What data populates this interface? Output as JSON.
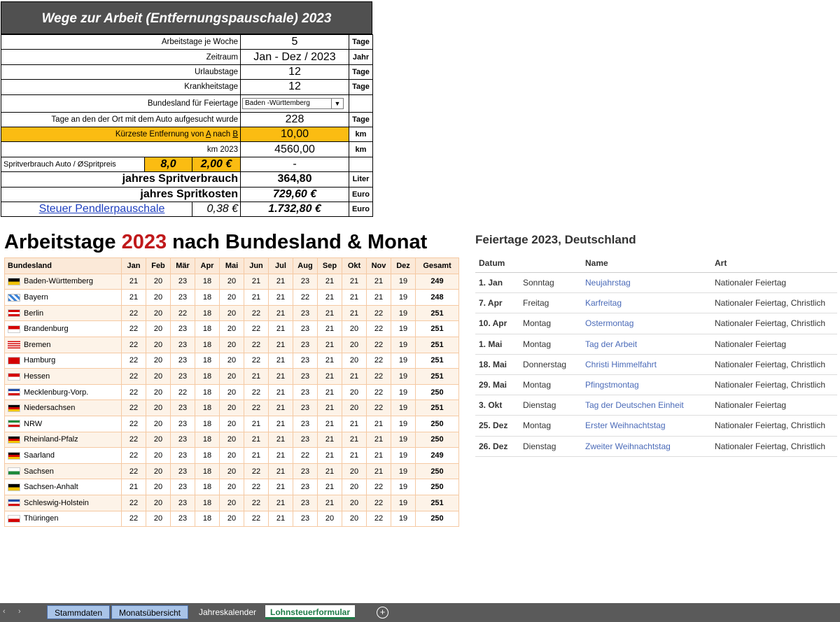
{
  "calc": {
    "title": "Wege zur Arbeit  (Entfernungspauschale)  2023",
    "rows": {
      "arbeitstage": {
        "label": "Arbeitstage je Woche",
        "value": "5",
        "unit": "Tage"
      },
      "zeitraum": {
        "label": "Zeitraum",
        "value": "Jan - Dez / 2023",
        "unit": "Jahr"
      },
      "urlaub": {
        "label": "Urlaubstage",
        "value": "12",
        "unit": "Tage"
      },
      "krank": {
        "label": "Krankheitstage",
        "value": "12",
        "unit": "Tage"
      },
      "bundesland": {
        "label": "Bundesland für Feiertage",
        "value": "Baden -Württemberg"
      },
      "tage_ort": {
        "label": "Tage an den der Ort mit dem Auto aufgesucht wurde",
        "value": "228",
        "unit": "Tage"
      },
      "entfernung": {
        "label_pre": "Kürzeste Entfernung von ",
        "label_a": "A",
        "label_mid": " nach ",
        "label_b": "B",
        "value": "10,00",
        "unit": "km"
      },
      "km": {
        "label": "km 2023",
        "value": "4560,00",
        "unit": "km"
      },
      "sprit": {
        "label": "Spritverbrauch Auto / ØSpritpreis",
        "verbrauch": "8,0",
        "preis": "2,00 €",
        "value": "-"
      },
      "jahresverbrauch": {
        "label": "jahres Spritverbrauch",
        "value": "364,80",
        "unit": "Liter"
      },
      "jahreskosten": {
        "label": "jahres Spritkosten",
        "value": "729,60 €",
        "unit": "Euro"
      },
      "pendler": {
        "label": "Steuer Pendlerpauschale",
        "rate": "0,38 €",
        "value": "1.732,80 €",
        "unit": "Euro"
      }
    }
  },
  "workdays": {
    "title_pre": "Arbeitstage ",
    "title_year": "2023",
    "title_post": " nach Bundesland & Monat",
    "headers": [
      "Bundesland",
      "Jan",
      "Feb",
      "Mär",
      "Apr",
      "Mai",
      "Jun",
      "Jul",
      "Aug",
      "Sep",
      "Okt",
      "Nov",
      "Dez",
      "Gesamt"
    ],
    "rows": [
      {
        "land": "Baden-Württemberg",
        "flag": [
          "#000000",
          "#f2c300"
        ],
        "m": [
          "21",
          "20",
          "23",
          "18",
          "20",
          "21",
          "21",
          "23",
          "21",
          "21",
          "21",
          "19"
        ],
        "sum": "249"
      },
      {
        "land": "Bayern",
        "flag": [
          "bayern"
        ],
        "m": [
          "21",
          "20",
          "23",
          "18",
          "20",
          "21",
          "21",
          "22",
          "21",
          "21",
          "21",
          "19"
        ],
        "sum": "248"
      },
      {
        "land": "Berlin",
        "flag": [
          "#d40000",
          "#ffffff",
          "#d40000"
        ],
        "m": [
          "22",
          "20",
          "22",
          "18",
          "20",
          "22",
          "21",
          "23",
          "21",
          "21",
          "22",
          "19"
        ],
        "sum": "251"
      },
      {
        "land": "Brandenburg",
        "flag": [
          "#d40000",
          "#ffffff"
        ],
        "m": [
          "22",
          "20",
          "23",
          "18",
          "20",
          "22",
          "21",
          "23",
          "21",
          "20",
          "22",
          "19"
        ],
        "sum": "251"
      },
      {
        "land": "Bremen",
        "flag": [
          "stripes-red"
        ],
        "m": [
          "22",
          "20",
          "23",
          "18",
          "20",
          "22",
          "21",
          "23",
          "21",
          "20",
          "22",
          "19"
        ],
        "sum": "251"
      },
      {
        "land": "Hamburg",
        "flag": [
          "#d40000"
        ],
        "m": [
          "22",
          "20",
          "23",
          "18",
          "20",
          "22",
          "21",
          "23",
          "21",
          "20",
          "22",
          "19"
        ],
        "sum": "251"
      },
      {
        "land": "Hessen",
        "flag": [
          "#d40000",
          "#ffffff"
        ],
        "m": [
          "22",
          "20",
          "23",
          "18",
          "20",
          "21",
          "21",
          "23",
          "21",
          "21",
          "22",
          "19"
        ],
        "sum": "251"
      },
      {
        "land": "Mecklenburg-Vorp.",
        "flag": [
          "#1f4ca8",
          "#ffffff",
          "#d40000"
        ],
        "m": [
          "22",
          "20",
          "22",
          "18",
          "20",
          "22",
          "21",
          "23",
          "21",
          "20",
          "22",
          "19"
        ],
        "sum": "250"
      },
      {
        "land": "Niedersachsen",
        "flag": [
          "#000000",
          "#d40000",
          "#f2c300"
        ],
        "m": [
          "22",
          "20",
          "23",
          "18",
          "20",
          "22",
          "21",
          "23",
          "21",
          "20",
          "22",
          "19"
        ],
        "sum": "251"
      },
      {
        "land": "NRW",
        "flag": [
          "#1e8a3b",
          "#ffffff",
          "#d40000"
        ],
        "m": [
          "22",
          "20",
          "23",
          "18",
          "20",
          "21",
          "21",
          "23",
          "21",
          "21",
          "21",
          "19"
        ],
        "sum": "250"
      },
      {
        "land": "Rheinland-Pfalz",
        "flag": [
          "#000000",
          "#d40000",
          "#f2c300"
        ],
        "m": [
          "22",
          "20",
          "23",
          "18",
          "20",
          "21",
          "21",
          "23",
          "21",
          "21",
          "21",
          "19"
        ],
        "sum": "250"
      },
      {
        "land": "Saarland",
        "flag": [
          "#000000",
          "#d40000",
          "#f2c300"
        ],
        "m": [
          "22",
          "20",
          "23",
          "18",
          "20",
          "21",
          "21",
          "22",
          "21",
          "21",
          "21",
          "19"
        ],
        "sum": "249"
      },
      {
        "land": "Sachsen",
        "flag": [
          "#ffffff",
          "#1e8a3b"
        ],
        "m": [
          "22",
          "20",
          "23",
          "18",
          "20",
          "22",
          "21",
          "23",
          "21",
          "20",
          "21",
          "19"
        ],
        "sum": "250"
      },
      {
        "land": "Sachsen-Anhalt",
        "flag": [
          "#000000",
          "#f2c300"
        ],
        "m": [
          "21",
          "20",
          "23",
          "18",
          "20",
          "22",
          "21",
          "23",
          "21",
          "20",
          "22",
          "19"
        ],
        "sum": "250"
      },
      {
        "land": "Schleswig-Holstein",
        "flag": [
          "#1f4ca8",
          "#ffffff",
          "#d40000"
        ],
        "m": [
          "22",
          "20",
          "23",
          "18",
          "20",
          "22",
          "21",
          "23",
          "21",
          "20",
          "22",
          "19"
        ],
        "sum": "251"
      },
      {
        "land": "Thüringen",
        "flag": [
          "#ffffff",
          "#d40000"
        ],
        "m": [
          "22",
          "20",
          "23",
          "18",
          "20",
          "22",
          "21",
          "23",
          "20",
          "20",
          "22",
          "19"
        ],
        "sum": "250"
      }
    ]
  },
  "holidays": {
    "title": "Feiertage 2023, Deutschland",
    "headers": {
      "datum": "Datum",
      "name": "Name",
      "art": "Art"
    },
    "rows": [
      {
        "datum": "1. Jan",
        "tag": "Sonntag",
        "name": "Neujahrstag",
        "art": "Nationaler Feiertag"
      },
      {
        "datum": "7. Apr",
        "tag": "Freitag",
        "name": "Karfreitag",
        "art": "Nationaler Feiertag, Christlich"
      },
      {
        "datum": "10. Apr",
        "tag": "Montag",
        "name": "Ostermontag",
        "art": "Nationaler Feiertag, Christlich"
      },
      {
        "datum": "1. Mai",
        "tag": "Montag",
        "name": "Tag der Arbeit",
        "art": "Nationaler Feiertag"
      },
      {
        "datum": "18. Mai",
        "tag": "Donnerstag",
        "name": "Christi Himmelfahrt",
        "art": "Nationaler Feiertag, Christlich"
      },
      {
        "datum": "29. Mai",
        "tag": "Montag",
        "name": "Pfingstmontag",
        "art": "Nationaler Feiertag, Christlich"
      },
      {
        "datum": "3. Okt",
        "tag": "Dienstag",
        "name": "Tag der Deutschen Einheit",
        "art": "Nationaler Feiertag"
      },
      {
        "datum": "25. Dez",
        "tag": "Montag",
        "name": "Erster Weihnachtstag",
        "art": "Nationaler Feiertag, Christlich"
      },
      {
        "datum": "26. Dez",
        "tag": "Dienstag",
        "name": "Zweiter Weihnachtstag",
        "art": "Nationaler Feiertag, Christlich"
      }
    ]
  },
  "tabs": {
    "stammdaten": "Stammdaten",
    "monats": "Monatsübersicht",
    "jahres": "Jahreskalender",
    "lohn": "Lohnsteuerformular",
    "nav_prev": "‹",
    "nav_next": "›",
    "add": "+"
  },
  "colors": {
    "yellow": "#fbbc12",
    "title_bg": "#505050",
    "year_red": "#c0191b",
    "active_tab": "#1e7b47",
    "link_blue": "#4a6ab8"
  }
}
